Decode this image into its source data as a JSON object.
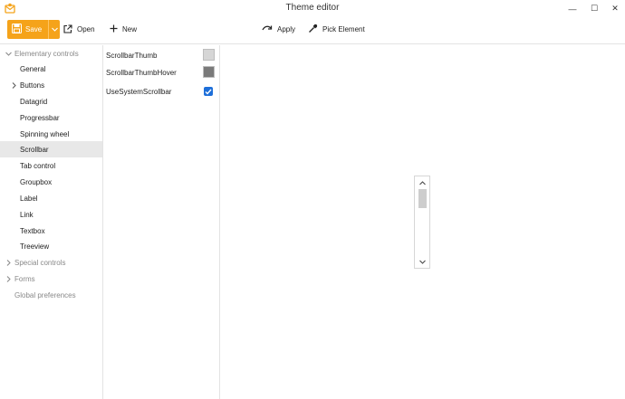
{
  "window": {
    "title": "Theme editor",
    "minimize_glyph": "—",
    "maximize_glyph": "☐",
    "close_glyph": "✕"
  },
  "toolbar": {
    "save_label": "Save",
    "open_label": "Open",
    "new_label": "New",
    "apply_label": "Apply",
    "pick_label": "Pick Element"
  },
  "tree": {
    "items": [
      {
        "label": "Elementary controls",
        "kind": "group",
        "expanded": true
      },
      {
        "label": "General"
      },
      {
        "label": "Buttons",
        "collapsed_children": true
      },
      {
        "label": "Datagrid"
      },
      {
        "label": "Progressbar"
      },
      {
        "label": "Spinning wheel"
      },
      {
        "label": "Scrollbar",
        "selected": true
      },
      {
        "label": "Tab control"
      },
      {
        "label": "Groupbox"
      },
      {
        "label": "Label"
      },
      {
        "label": "Link"
      },
      {
        "label": "Textbox"
      },
      {
        "label": "Treeview"
      },
      {
        "label": "Special controls",
        "kind": "group",
        "expanded": false
      },
      {
        "label": "Forms",
        "kind": "group",
        "expanded": false
      },
      {
        "label": "Global preferences",
        "kind": "group"
      }
    ]
  },
  "properties": [
    {
      "name": "ScrollbarThumb",
      "type": "color",
      "value": "#d6d6d6"
    },
    {
      "name": "ScrollbarThumbHover",
      "type": "color",
      "value": "#7a7a7a"
    },
    {
      "name": "UseSystemScrollbar",
      "type": "bool",
      "value": true
    }
  ],
  "colors": {
    "accent": "#f5a31a",
    "selection": "#e8e8e8",
    "checkbox": "#1e6fd9"
  }
}
